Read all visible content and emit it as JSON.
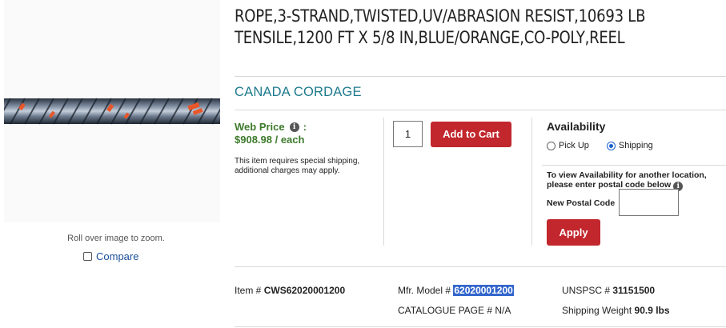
{
  "product": {
    "title": "ROPE,3-STRAND,TWISTED,UV/ABRASION RESIST,10693 LB TENSILE,1200 FT X 5/8 IN,BLUE/ORANGE,CO-POLY,REEL",
    "brand": "CANADA CORDAGE",
    "image_hint": "Roll over image to zoom.",
    "compare_label": "Compare"
  },
  "pricing": {
    "web_price_label": "Web Price",
    "colon": ":",
    "price": "$908.98 / each",
    "shipping_note": "This item requires special shipping, additional charges may apply.",
    "accent_color": "#3d7a2b"
  },
  "cart": {
    "quantity": "1",
    "add_to_cart_label": "Add to Cart",
    "button_color": "#c1272d"
  },
  "availability": {
    "title": "Availability",
    "pickup_label": "Pick Up",
    "shipping_label": "Shipping",
    "selected": "Shipping",
    "view_note": "To view Availability for another location, please enter postal code below",
    "postal_label": "New Postal Code",
    "postal_value": "",
    "apply_label": "Apply"
  },
  "details": {
    "item_label": "Item #",
    "item_value": "CWS62020001200",
    "mfr_label": "Mfr. Model #",
    "mfr_value": "62020001200",
    "catalogue_label": "CATALOGUE PAGE #",
    "catalogue_value": "N/A",
    "unspsc_label": "UNSPSC #",
    "unspsc_value": "31151500",
    "weight_label": "Shipping Weight",
    "weight_value": "90.9 lbs"
  }
}
